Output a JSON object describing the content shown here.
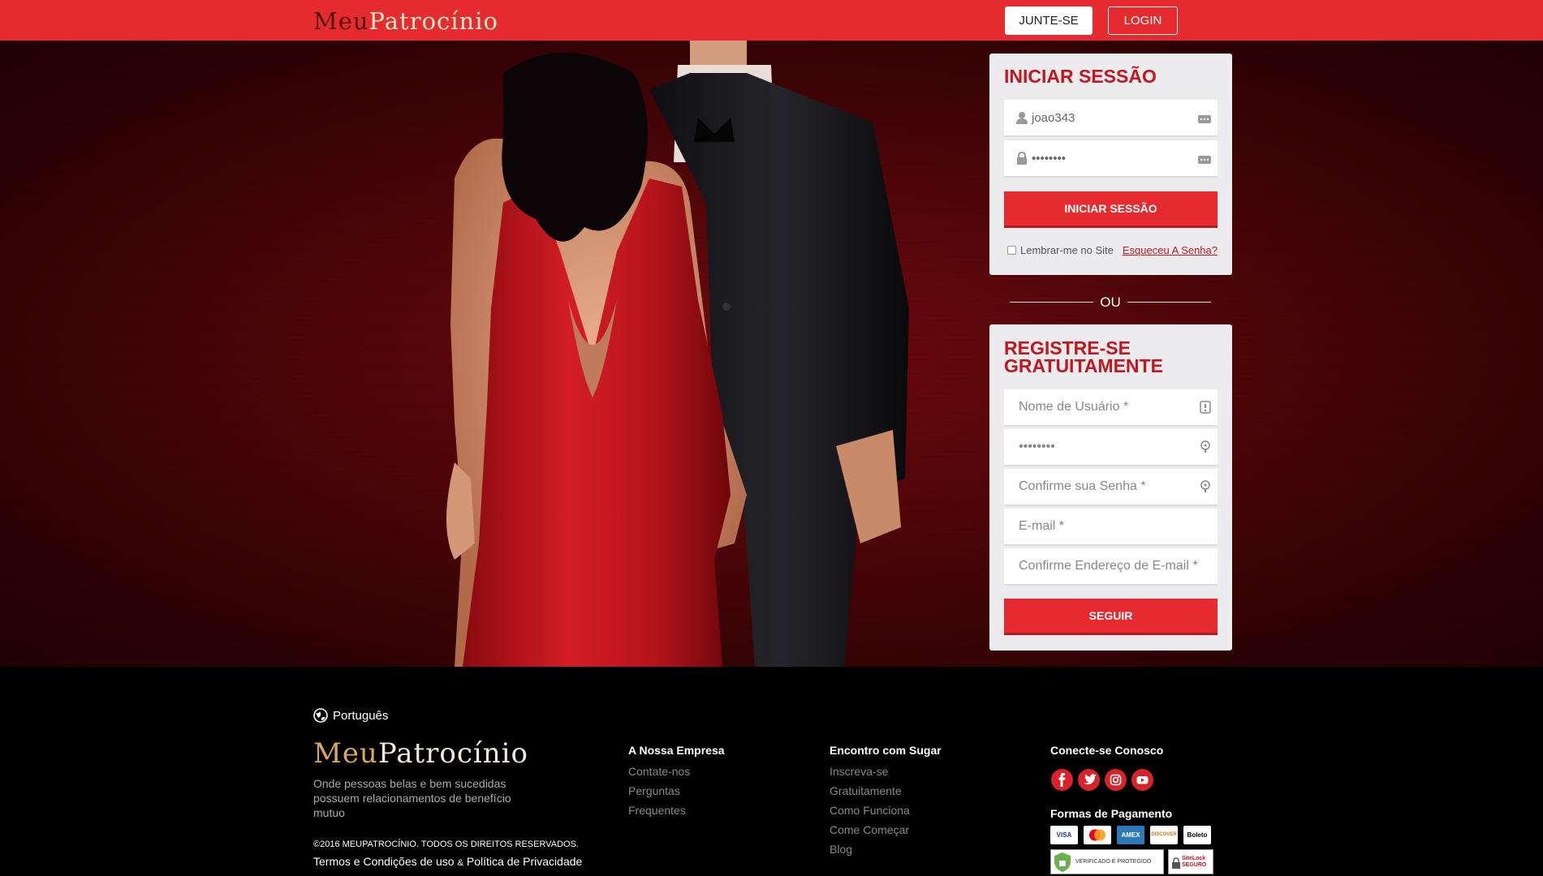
{
  "header": {
    "logo_part1": "Meu",
    "logo_part2": "Patrocínio",
    "join_label": "JUNTE-SE",
    "login_label": "LOGIN"
  },
  "login_panel": {
    "title": "INICIAR SESSÃO",
    "username_value": "joao343",
    "password_value": "••••••••",
    "submit_label": "INICIAR SESSÃO",
    "remember_label": "Lembrar-me no Site",
    "forgot_label": "Esqueceu A Senha?"
  },
  "divider_label": "OU",
  "register_panel": {
    "title_line1": "REGISTRE-SE",
    "title_line2": "GRATUITAMENTE",
    "username_placeholder": "Nome de Usuário *",
    "password_value": "••••••••",
    "confirm_password_placeholder": "Confirme sua Senha *",
    "email_placeholder": "E-mail *",
    "confirm_email_placeholder": "Confirme Endereço de E-mail *",
    "submit_label": "SEGUIR"
  },
  "footer": {
    "language": "Português",
    "logo_part1": "Meu",
    "logo_part2": "Patrocínio",
    "tagline": "Onde pessoas belas e bem sucedidas possuem relacionamentos de benefício mutuo",
    "copyright": "©2016 MEUPATROCÍNIO. TODOS OS DIREITOS RESERVADOS.",
    "terms_label": "Termos e Condições de uso",
    "amp": "&",
    "privacy_label": "Política de Privacidade",
    "col1": {
      "title": "A Nossa Empresa",
      "links": [
        "Contate-nos",
        "Perguntas",
        "Frequentes"
      ]
    },
    "col2": {
      "title": "Encontro com Sugar",
      "links": [
        "Inscreva-se",
        "Gratuitamente",
        "Como Funciona",
        "Come Começar",
        "Blog"
      ]
    },
    "col3": {
      "title": "Conecte-se Conosco",
      "social": [
        "facebook-icon",
        "twitter-icon",
        "instagram-icon",
        "youtube-icon"
      ],
      "payment_title": "Formas de Pagamento",
      "cards": [
        "VISA",
        "mastercard",
        "AMEX",
        "DISCOVER",
        "Boleto"
      ],
      "badge1": "VERIFICADO E PROTEGIDO",
      "badge2": "SiteLock SEGURO"
    }
  },
  "colors": {
    "brand_red": "#e52a30",
    "title_red": "#c3161f",
    "panel_bg": "#ececee",
    "footer_bg": "#000000"
  }
}
